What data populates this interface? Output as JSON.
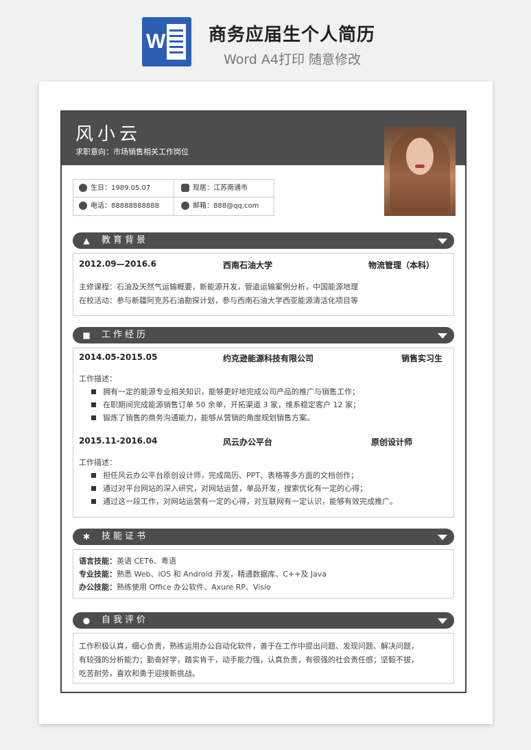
{
  "banner": {
    "icon_letter": "W",
    "title": "商务应届生个人简历",
    "subtitle": "Word A4打印 随意修改"
  },
  "header": {
    "name": "风小云",
    "intent": "求职意向：市场销售相关工作岗位"
  },
  "contact": {
    "birthday": "生日：1989.05.07",
    "residence": "现居：江苏南通市",
    "phone": "电话：88888888888",
    "email": "邮箱：888@qq.com"
  },
  "education": {
    "title": "教育背景",
    "period": "2012.09—2016.6",
    "school": "西南石油大学",
    "major": "物流管理（本科）",
    "courses": "主修课程：石油及天然气运输概要，新能源开发，管道运输案例分析，中国能源地理",
    "activities": "在校活动：参与新疆阿克苏石油勘探计划，参与西南石油大学西亚能源清洁化项目等"
  },
  "work": {
    "title": "工作经历",
    "jobs": [
      {
        "period": "2014.05-2015.05",
        "company": "约克逊能源科技有限公司",
        "role": "销售实习生",
        "desc_label": "工作描述：",
        "items": [
          "拥有一定的能源专业相关知识，能够更好地完成公司产品的推广与销售工作；",
          "在职期间完成能源销售订单 50 余单，开拓渠道 3 家，维系稳定客户 12 家；",
          "锻炼了销售的商务沟通能力，能够从营销的角度规划销售方案。"
        ]
      },
      {
        "period": "2015.11-2016.04",
        "company": "风云办公平台",
        "role": "原创设计师",
        "desc_label": "工作描述：",
        "items": [
          "担任风云办公平台原创设计师，完成简历、PPT、表格等多方面的文档创作；",
          "通过对平台网站的深入研究，对网站运营，单品开发，搜索优化有一定的心得；",
          "通过这一段工作，对网站运营有一定的心得，对互联网有一定认识，能够有效完成推广。"
        ]
      }
    ]
  },
  "skills": {
    "title": "技能证书",
    "lang_label": "语言技能：",
    "lang_value": "英语 CET6、粤语",
    "pro_label": "专业技能：",
    "pro_value": "熟悉 Web、iOS 和 Android 开发，精通数据库、C++及 Java",
    "office_label": "办公技能：",
    "office_value": "熟练使用 Office 办公软件、Axure RP、Visio"
  },
  "self": {
    "title": "自我评价",
    "lines": [
      "工作积极认真，细心负责，熟练运用办公自动化软件，善于在工作中提出问题、发现问题、解决问题，",
      "有较强的分析能力；勤奋好学，踏实肯干，动手能力强，认真负责，有很强的社会责任感；坚毅不拔，",
      "吃苦耐劳，喜欢和勇于迎接新挑战。"
    ]
  },
  "icons": {
    "education": "graduation-cap-icon",
    "work": "briefcase-icon",
    "skills": "gear-icon",
    "self": "person-icon",
    "collapse": "triangle-down-icon"
  },
  "colors": {
    "header": "#4d4d4d",
    "word_blue": "#2b5fb3"
  }
}
